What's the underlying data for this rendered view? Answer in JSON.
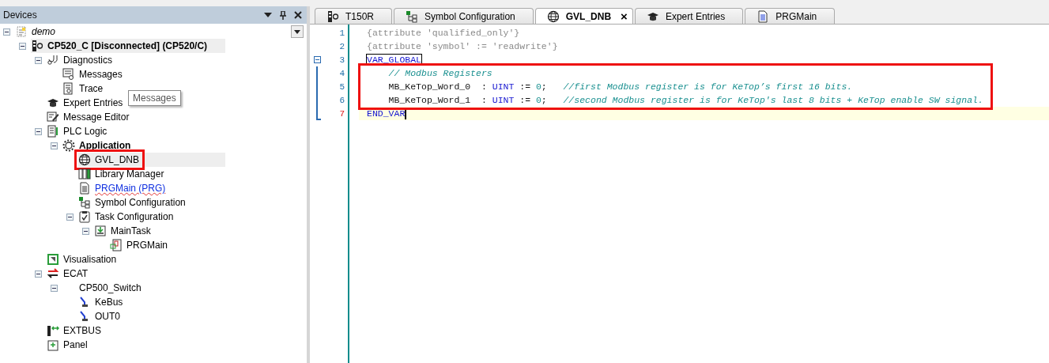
{
  "devices_panel": {
    "title": "Devices",
    "tree": [
      {
        "label": "demo",
        "kind": "project",
        "expanded": true,
        "selected": false,
        "annotated": false,
        "children": [
          {
            "label": "CP520_C [Disconnected] (CP520/C)",
            "kind": "device",
            "expanded": true,
            "selected": true,
            "annotated": false,
            "children": [
              {
                "label": "Diagnostics",
                "kind": "diagnostics",
                "expanded": true,
                "selected": false,
                "annotated": false,
                "children": [
                  {
                    "label": "Messages",
                    "kind": "messages",
                    "selected": false,
                    "annotated": false
                  },
                  {
                    "label": "Trace",
                    "kind": "trace",
                    "selected": false,
                    "annotated": false
                  }
                ]
              },
              {
                "label": "Expert Entries",
                "kind": "expert",
                "selected": false,
                "annotated": false
              },
              {
                "label": "Message Editor",
                "kind": "editor",
                "selected": false,
                "annotated": false
              },
              {
                "label": "PLC Logic",
                "kind": "plc",
                "expanded": true,
                "selected": false,
                "annotated": false,
                "children": [
                  {
                    "label": "Application",
                    "kind": "application",
                    "expanded": true,
                    "selected": false,
                    "annotated": false,
                    "children": [
                      {
                        "label": "GVL_DNB",
                        "kind": "globe",
                        "selected": true,
                        "annotated": true
                      },
                      {
                        "label": "Library Manager",
                        "kind": "library",
                        "selected": false,
                        "annotated": false
                      },
                      {
                        "label": "PRGMain (PRG)",
                        "kind": "pou",
                        "selected": false,
                        "annotated": false
                      },
                      {
                        "label": "Symbol Configuration",
                        "kind": "symbols",
                        "selected": false,
                        "annotated": false
                      },
                      {
                        "label": "Task Configuration",
                        "kind": "tasks",
                        "expanded": true,
                        "selected": false,
                        "annotated": false,
                        "children": [
                          {
                            "label": "MainTask",
                            "kind": "task",
                            "expanded": true,
                            "selected": false,
                            "annotated": false,
                            "children": [
                              {
                                "label": "PRGMain",
                                "kind": "program",
                                "selected": false,
                                "annotated": false
                              }
                            ]
                          }
                        ]
                      }
                    ]
                  }
                ]
              },
              {
                "label": "Visualisation",
                "kind": "visual",
                "selected": false,
                "annotated": false
              },
              {
                "label": "ECAT",
                "kind": "ecat",
                "expanded": true,
                "selected": false,
                "annotated": false,
                "children": [
                  {
                    "label": "CP500_Switch",
                    "kind": "switch",
                    "expanded": true,
                    "selected": false,
                    "annotated": false,
                    "children": [
                      {
                        "label": "KeBus",
                        "kind": "port",
                        "selected": false,
                        "annotated": false
                      },
                      {
                        "label": "OUT0",
                        "kind": "port",
                        "selected": false,
                        "annotated": false
                      }
                    ]
                  }
                ]
              },
              {
                "label": "EXTBUS",
                "kind": "extbus",
                "selected": false,
                "annotated": false
              },
              {
                "label": "Panel",
                "kind": "panel",
                "selected": false,
                "annotated": false
              }
            ]
          }
        ]
      }
    ],
    "tooltip": "Messages"
  },
  "editor": {
    "tabs": [
      {
        "label": "T150R",
        "kind": "device",
        "selected": false
      },
      {
        "label": "Symbol Configuration",
        "kind": "symbols",
        "selected": false
      },
      {
        "label": "GVL_DNB",
        "kind": "globe",
        "selected": true,
        "close": "×"
      },
      {
        "label": "Expert Entries",
        "kind": "expert",
        "selected": false
      },
      {
        "label": "PRGMain",
        "kind": "document",
        "selected": false
      }
    ],
    "lines": [
      {
        "number": "1",
        "current": false,
        "annotated": false,
        "tokens": [
          {
            "text": "{attribute 'qualified_only'}",
            "kind": "pragma"
          }
        ]
      },
      {
        "number": "2",
        "current": false,
        "annotated": false,
        "tokens": [
          {
            "text": "{attribute 'symbol' := 'readwrite'}",
            "kind": "pragma"
          }
        ]
      },
      {
        "number": "3",
        "current": false,
        "annotated": false,
        "fold": true,
        "tokens": [
          {
            "text": "VAR_GLOBAL",
            "kind": "keyword",
            "boxed": true
          }
        ]
      },
      {
        "number": "4",
        "current": false,
        "annotated": true,
        "tokens": [
          {
            "text": "    // Modbus Registers",
            "kind": "comment"
          }
        ]
      },
      {
        "number": "5",
        "current": false,
        "annotated": true,
        "tokens": [
          {
            "text": "    MB_KeTop_Word_0  : ",
            "kind": "plain"
          },
          {
            "text": "UINT",
            "kind": "keyword"
          },
          {
            "text": " := ",
            "kind": "plain"
          },
          {
            "text": "0",
            "kind": "number"
          },
          {
            "text": ";   ",
            "kind": "plain"
          },
          {
            "text": "//first Modbus register is for KeTop’s first 16 bits.",
            "kind": "comment"
          }
        ]
      },
      {
        "number": "6",
        "current": false,
        "annotated": true,
        "tokens": [
          {
            "text": "    MB_KeTop_Word_1  : ",
            "kind": "plain"
          },
          {
            "text": "UINT",
            "kind": "keyword"
          },
          {
            "text": " := ",
            "kind": "plain"
          },
          {
            "text": "0",
            "kind": "number"
          },
          {
            "text": ";   ",
            "kind": "plain"
          },
          {
            "text": "//second Modbus register is for KeTop's last 8 bits + KeTop enable SW signal.",
            "kind": "comment"
          }
        ]
      },
      {
        "number": "7",
        "current": true,
        "annotated": false,
        "tokens": [
          {
            "text": "END_VAR",
            "kind": "keyword"
          }
        ]
      }
    ]
  }
}
